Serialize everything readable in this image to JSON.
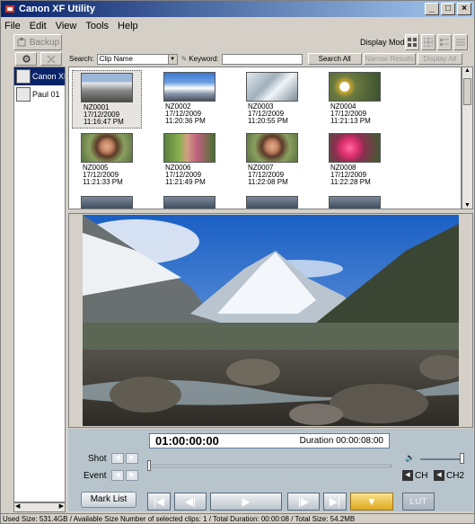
{
  "window": {
    "title": "Canon XF Utility"
  },
  "menu": [
    "File",
    "Edit",
    "View",
    "Tools",
    "Help"
  ],
  "toolbar": {
    "backup_label": "Backup",
    "display_mode_label": "Display Mode:"
  },
  "search": {
    "search_label": "Search:",
    "search_value": "Clip Name",
    "keyword_label": "Keyword:",
    "keyword_value": "",
    "search_all_label": "Search All",
    "narrow_results_label": "Narrow Results",
    "display_all_label": "Display All"
  },
  "sidebar": {
    "items": [
      {
        "label": "Canon XF",
        "selected": true
      },
      {
        "label": "Paul 01",
        "selected": false
      }
    ]
  },
  "clips": [
    {
      "name": "NZ0001",
      "date": "17/12/2009",
      "time": "11:16:47 PM",
      "thumb": "mountain"
    },
    {
      "name": "NZ0002",
      "date": "17/12/2009",
      "time": "11:20:36 PM",
      "thumb": "snowpeak"
    },
    {
      "name": "NZ0003",
      "date": "17/12/2009",
      "time": "11:20:55 PM",
      "thumb": "ice"
    },
    {
      "name": "NZ0004",
      "date": "17/12/2009",
      "time": "11:21:13 PM",
      "thumb": "flowers"
    },
    {
      "name": "NZ0005",
      "date": "17/12/2009",
      "time": "11:21:33 PM",
      "thumb": "portrait"
    },
    {
      "name": "NZ0006",
      "date": "17/12/2009",
      "time": "11:21:49 PM",
      "thumb": "portrait-garden"
    },
    {
      "name": "NZ0007",
      "date": "17/12/2009",
      "time": "11:22:08 PM",
      "thumb": "portrait"
    },
    {
      "name": "NZ0008",
      "date": "17/12/2009",
      "time": "11:22:28 PM",
      "thumb": "pink-flowers"
    }
  ],
  "player": {
    "timecode": "01:00:00:00",
    "duration": "Duration 00:00:08:00",
    "shot_label": "Shot",
    "event_label": "Event",
    "mark_list_label": "Mark List",
    "ch1_label": "CH",
    "ch2_label": "CH2",
    "lut_label": "LUT"
  },
  "status": {
    "text": "Used Size: 531.4GB / Available Size Number of selected clips: 1 / Total Duration: 00:00:08 / Total Size: 54.2MB"
  },
  "colors": {
    "title_bar": "#0a246a",
    "selection": "#0a246a",
    "control_panel": "#b8c4cc",
    "mark_button": "#f0c030"
  }
}
